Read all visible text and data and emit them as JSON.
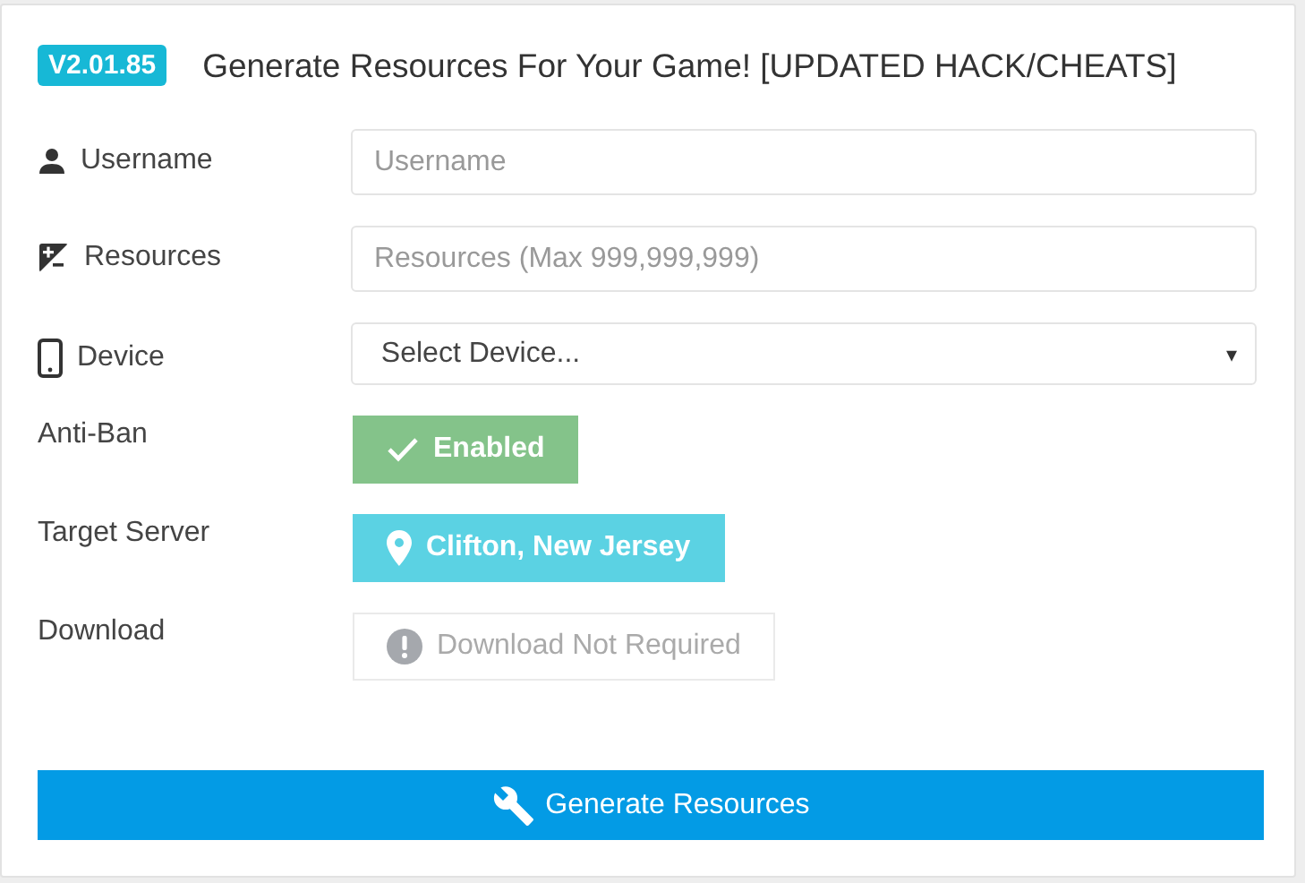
{
  "header": {
    "badge": "V2.01.85",
    "title": "Generate Resources For Your Game! [UPDATED HACK/CHEATS]"
  },
  "rows": [
    {
      "kind": "input",
      "label": "Username",
      "placeholder": "Username"
    },
    {
      "kind": "input",
      "label": "Resources",
      "placeholder": "Resources (Max 999,999,999)"
    },
    {
      "kind": "select",
      "label": "Device",
      "value": "Select Device...",
      "caret": "▾"
    },
    {
      "kind": "status",
      "label": "Anti-Ban",
      "color": "#84c38a",
      "disabled": false,
      "text": "Enabled"
    },
    {
      "kind": "status",
      "label": "Target Server",
      "color": "#5bd2e3",
      "disabled": false,
      "text": "Clifton, New Jersey"
    },
    {
      "kind": "status",
      "label": "Download",
      "disabled": true,
      "text": "Download Not Required"
    }
  ],
  "submit": {
    "label": "Generate Resources"
  }
}
